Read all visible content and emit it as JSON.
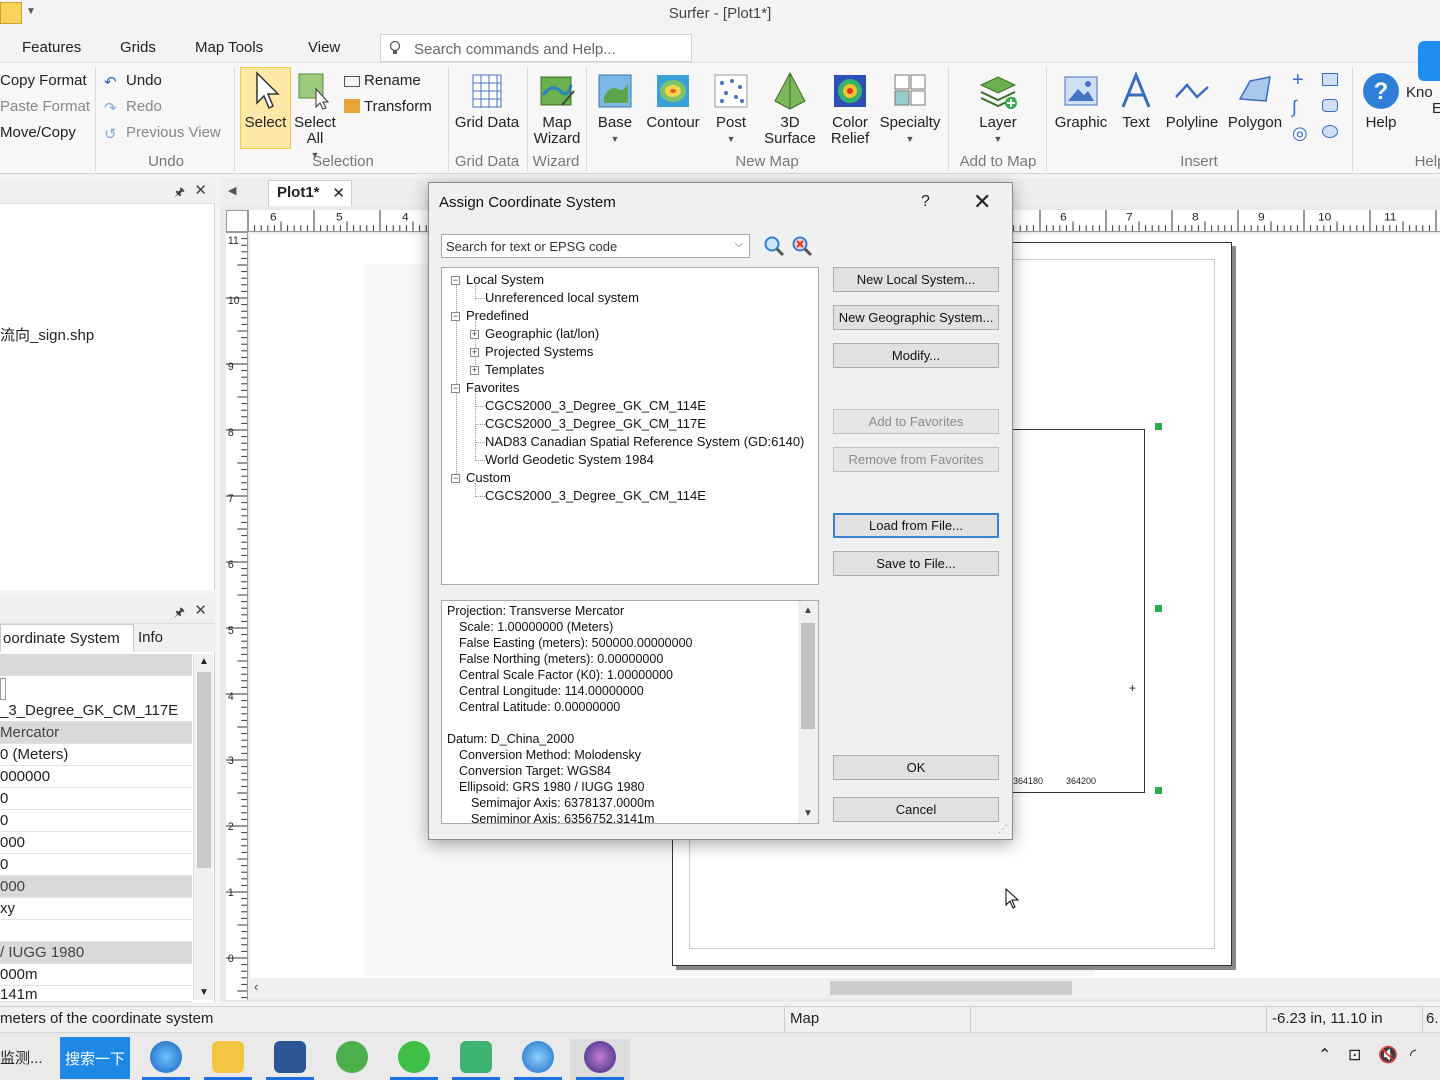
{
  "window": {
    "title": "Surfer - [Plot1*]"
  },
  "menu": {
    "items": [
      "Features",
      "Grids",
      "Map Tools",
      "View"
    ],
    "search_placeholder": "Search commands and Help..."
  },
  "ribbon": {
    "clipboard": {
      "copy_format": "Copy Format",
      "paste_format": "Paste Format",
      "move_copy": "Move/Copy"
    },
    "undo": {
      "undo": "Undo",
      "redo": "Redo",
      "previous_view": "Previous View",
      "label": "Undo"
    },
    "selection": {
      "select": "Select",
      "select_all": "Select All",
      "rename": "Rename",
      "transform": "Transform",
      "label": "Selection"
    },
    "grid_data": {
      "button": "Grid Data",
      "label": "Grid Data"
    },
    "wizard": {
      "button": "Map Wizard",
      "label": "Wizard"
    },
    "new_map": {
      "base": "Base",
      "contour": "Contour",
      "post": "Post",
      "surface": "3D Surface",
      "color_relief": "Color Relief",
      "specialty": "Specialty",
      "label": "New Map"
    },
    "add_to_map": {
      "layer": "Layer",
      "label": "Add to Map"
    },
    "insert": {
      "graphic": "Graphic",
      "text": "Text",
      "polyline": "Polyline",
      "polygon": "Polygon",
      "label": "Insert"
    },
    "help": {
      "help": "Help",
      "knowledge": "Kno",
      "knowledge2": "E",
      "label": "Help"
    }
  },
  "left_pane_top": {
    "file": "流向_sign.shp"
  },
  "left_pane_bottom": {
    "tabs": [
      "oordinate System",
      "Info"
    ],
    "rows": [
      "",
      "_3_Degree_GK_CM_117E",
      " Mercator",
      "0 (Meters)",
      "000000",
      "0",
      "0",
      "000",
      "0",
      "000",
      "xy",
      "",
      "/ IUGG 1980",
      "000m",
      "141m"
    ]
  },
  "document": {
    "tab": "Plot1*",
    "ruler_h": [
      "6",
      "5",
      "4",
      "6",
      "7",
      "8",
      "9",
      "10",
      "11"
    ],
    "ruler_v": [
      "11",
      "10",
      "9",
      "8",
      "7",
      "6",
      "5",
      "4",
      "3",
      "2",
      "1",
      "0"
    ],
    "map_ticks": [
      "364180",
      "364200"
    ]
  },
  "dialog": {
    "title": "Assign Coordinate System",
    "help": "?",
    "search_placeholder": "Search for text or EPSG code",
    "tree": {
      "local_system": "Local System",
      "unreferenced": "Unreferenced local system",
      "predefined": "Predefined",
      "geographic": "Geographic (lat/lon)",
      "projected": "Projected Systems",
      "templates": "Templates",
      "favorites": "Favorites",
      "fav1": "CGCS2000_3_Degree_GK_CM_114E",
      "fav2": "CGCS2000_3_Degree_GK_CM_117E",
      "fav3": "NAD83 Canadian Spatial Reference System (GD:6140)",
      "fav4": "World Geodetic System 1984",
      "custom": "Custom",
      "custom1": "CGCS2000_3_Degree_GK_CM_114E"
    },
    "buttons": {
      "new_local": "New Local System...",
      "new_geographic": "New Geographic System...",
      "modify": "Modify...",
      "add_fav": "Add to Favorites",
      "remove_fav": "Remove from Favorites",
      "load": "Load from File...",
      "save": "Save to File...",
      "ok": "OK",
      "cancel": "Cancel"
    },
    "details": [
      "Projection: Transverse Mercator",
      "Scale: 1.00000000 (Meters)",
      "False Easting (meters): 500000.00000000",
      "False Northing (meters): 0.00000000",
      "Central Scale Factor (K0): 1.00000000",
      "Central Longitude: 114.00000000",
      "Central Latitude: 0.00000000",
      "Datum: D_China_2000",
      "Conversion Method: Molodensky",
      "Conversion Target: WGS84",
      "Ellipsoid: GRS 1980 / IUGG 1980",
      "Semimajor Axis: 6378137.0000m",
      "Semiminor Axis: 6356752.3141m"
    ]
  },
  "status": {
    "hint": "meters of the coordinate system",
    "mode": "Map",
    "coords": "-6.23 in, 11.10 in",
    "extra": "6."
  },
  "taskbar": {
    "left_label": "监测...",
    "search": "搜索一下"
  }
}
